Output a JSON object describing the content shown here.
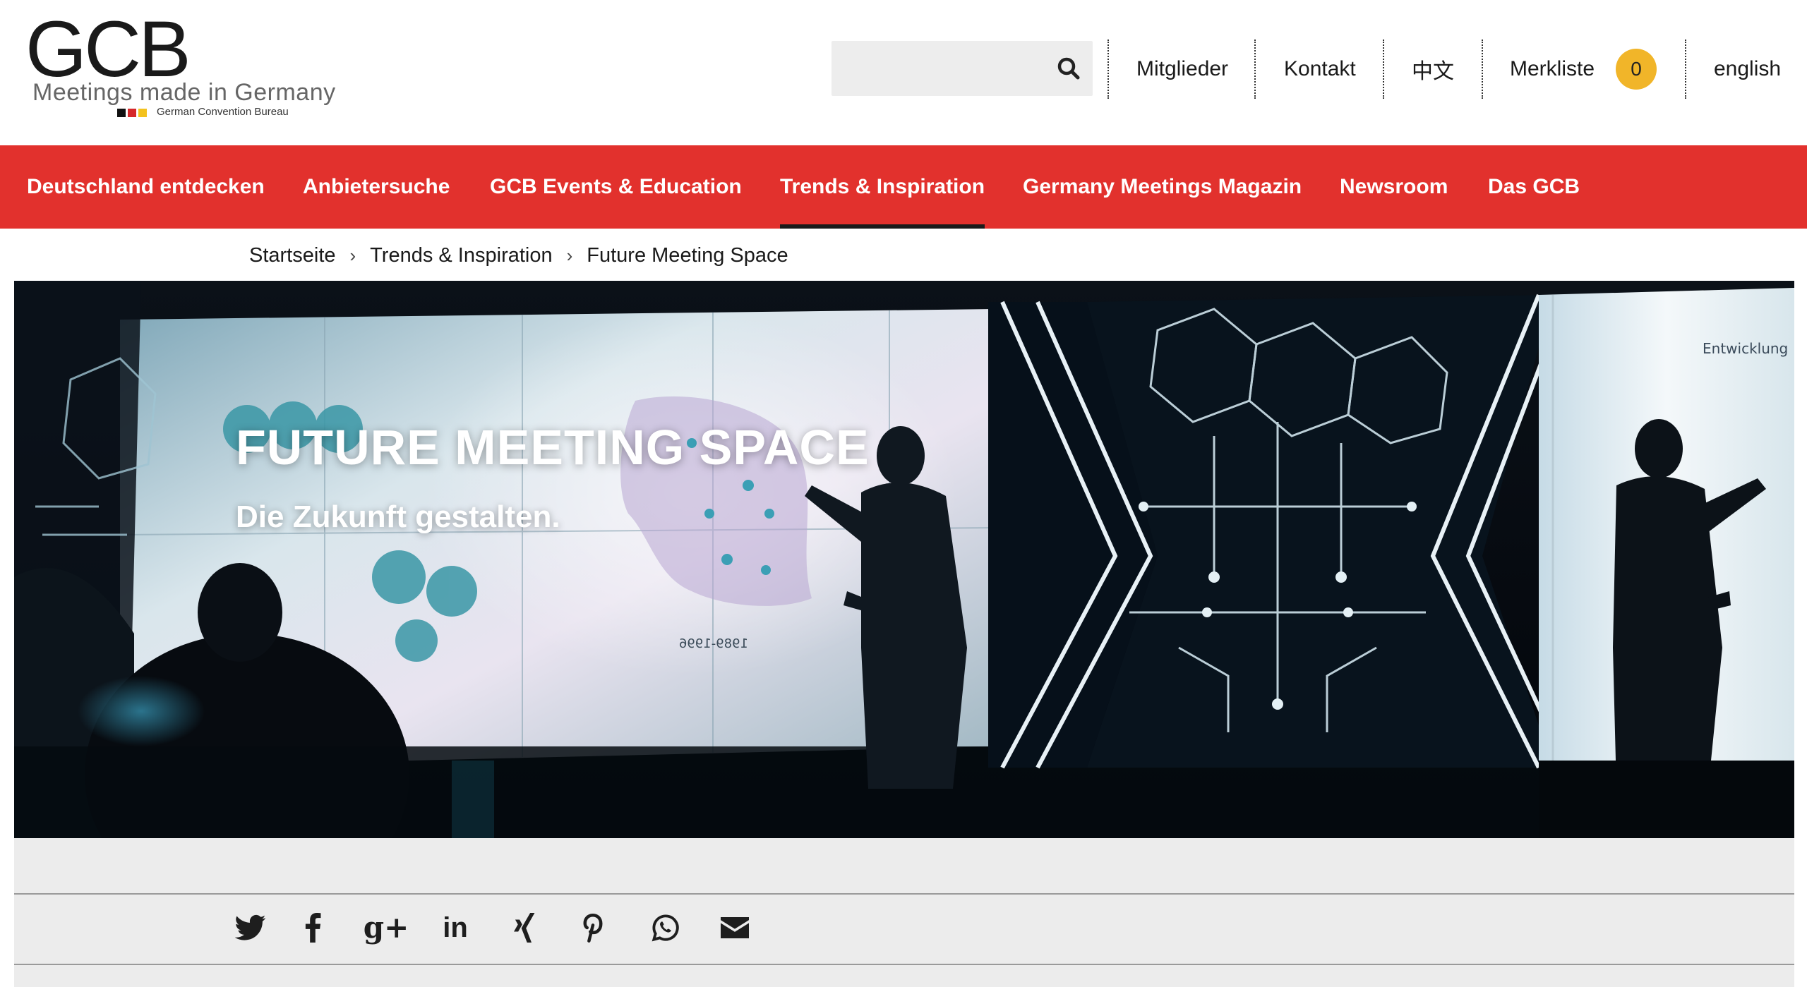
{
  "logo": {
    "brand": "GCB",
    "tagline": "Meetings made in Germany",
    "subline": "German Convention Bureau",
    "flag_colors": [
      "#111111",
      "#d6282a",
      "#f3c21e"
    ]
  },
  "search": {
    "placeholder": "",
    "icon": "search-icon"
  },
  "topnav": {
    "items": [
      {
        "label": "Mitglieder"
      },
      {
        "label": "Kontakt"
      },
      {
        "label": "中文"
      },
      {
        "label": "Merkliste"
      },
      {
        "label": "english"
      }
    ],
    "merkliste_count": "0"
  },
  "mainnav": {
    "items": [
      {
        "label": "Deutschland entdecken"
      },
      {
        "label": "Anbietersuche"
      },
      {
        "label": "GCB Events & Education"
      },
      {
        "label": "Trends & Inspiration",
        "active": true
      },
      {
        "label": "Germany Meetings Magazin"
      },
      {
        "label": "Newsroom"
      },
      {
        "label": "Das GCB"
      }
    ],
    "bg_color": "#e2312d"
  },
  "breadcrumb": {
    "items": [
      "Startseite",
      "Trends & Inspiration",
      "Future Meeting Space"
    ],
    "separator": "›"
  },
  "hero": {
    "title": "FUTURE MEETING SPACE",
    "subtitle": "Die Zukunft gestalten.",
    "screen_label": "Entwicklung"
  },
  "share": {
    "icons": [
      "twitter-icon",
      "facebook-icon",
      "google-plus-icon",
      "linkedin-icon",
      "xing-icon",
      "pinterest-icon",
      "whatsapp-icon",
      "email-icon"
    ],
    "linkedin_text": "in",
    "googleplus_text": "g+"
  }
}
